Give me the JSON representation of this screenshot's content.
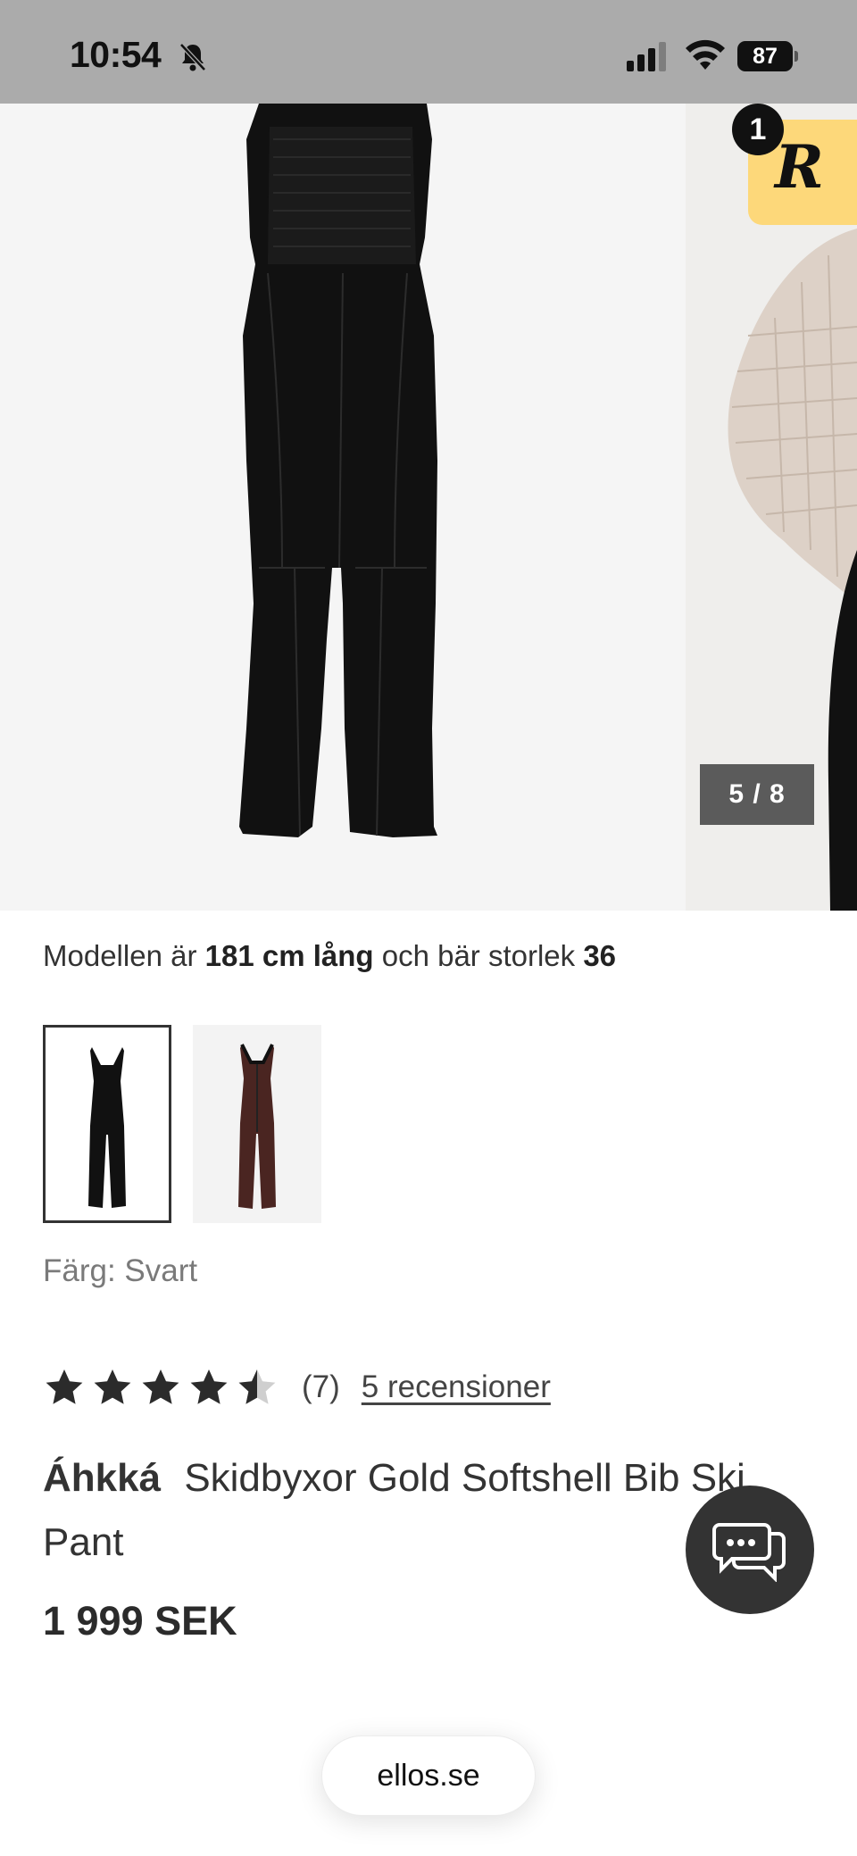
{
  "status_bar": {
    "time": "10:54",
    "battery": "87"
  },
  "gallery": {
    "pager": "5 / 8",
    "badge_logo": "R",
    "badge_count": "1"
  },
  "model_info": {
    "prefix": "Modellen är",
    "height": "181 cm lång",
    "middle": "och bär storlek",
    "size": "36"
  },
  "colors": {
    "label": "Färg: Svart",
    "options": [
      "black",
      "brown"
    ]
  },
  "rating": {
    "value": 4.5,
    "max": 5,
    "count": "(7)",
    "reviews_link": "5 recensioner"
  },
  "product": {
    "brand": "Áhkká",
    "name": "Skidbyxor Gold Softshell Bib Ski Pant",
    "price": "1 999 SEK"
  },
  "browser": {
    "url": "ellos.se"
  }
}
